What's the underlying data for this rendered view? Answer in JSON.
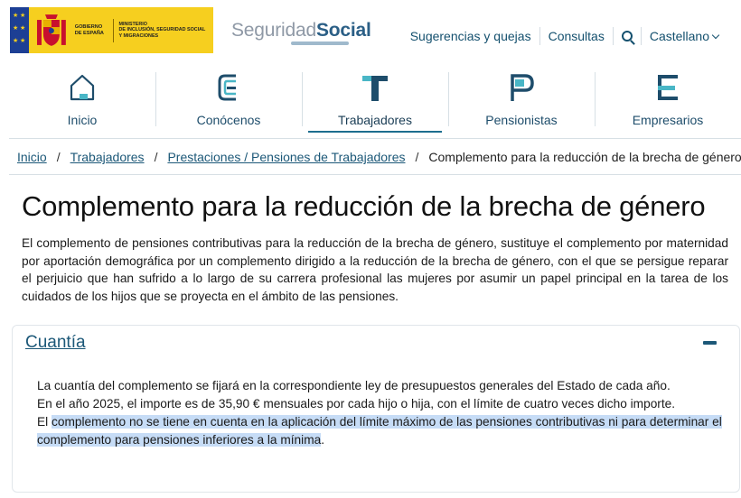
{
  "header": {
    "gov_logo": {
      "gov_line1": "GOBIERNO",
      "gov_line2": "DE ESPAÑA",
      "ministry_line1": "MINISTERIO",
      "ministry_line2": "DE INCLUSIÓN, SEGURIDAD SOCIAL",
      "ministry_line3": "Y MIGRACIONES",
      "colors": {
        "background": "#f6cf1f",
        "eu_blue": "#1d3f94"
      }
    },
    "brand": {
      "part1": "Seguridad",
      "part2": "Social"
    },
    "links": {
      "suggestions": "Sugerencias y quejas",
      "queries": "Consultas",
      "search_icon": "search-icon",
      "language": "Castellano"
    }
  },
  "nav": {
    "items": [
      {
        "label": "Inicio",
        "icon": "home-icon",
        "active": false
      },
      {
        "label": "Conócenos",
        "icon": "letter-c-icon",
        "active": false
      },
      {
        "label": "Trabajadores",
        "icon": "letter-t-icon",
        "active": true
      },
      {
        "label": "Pensionistas",
        "icon": "letter-p-icon",
        "active": false
      },
      {
        "label": "Empresarios",
        "icon": "letter-e-icon",
        "active": false
      }
    ],
    "accent_color": "#1d6e8f"
  },
  "breadcrumb": {
    "items": [
      "Inicio",
      "Trabajadores",
      "Prestaciones / Pensiones de Trabajadores"
    ],
    "separator": "/",
    "current": "Complemento para la reducción de la brecha de género"
  },
  "main": {
    "title": "Complemento para la reducción de la brecha de género",
    "intro": "El complemento de pensiones contributivas para la reducción de la brecha de género,  sustituye el complemento por maternidad por aportación demográfica por un complemento dirigido a la reducción de la brecha de género, con el que se persigue reparar el perjuicio que han sufrido a lo largo de su carrera profesional las mujeres por asumir un papel principal en la tarea de los cuidados de los hijos que se proyecta en el ámbito de las pensiones.",
    "accordion": {
      "title": "Cuantía",
      "toggle_icon": "collapse-icon",
      "lines": [
        "La cuantía  del complemento se fijará en la correspondiente ley de presupuestos generales del Estado de cada año.",
        "En el año 2025, el importe es de 35,90 € mensuales por cada hijo o hija, con el límite de cuatro veces dicho importe."
      ],
      "line3_prefix": "El ",
      "line3_highlighted": "complemento no se tiene en cuenta en la aplicación del límite máximo de las pensiones contributivas ni para determinar el complemento para pensiones inferiores a la mínima",
      "line3_suffix": ".",
      "highlight_color": "#c6dcf6"
    }
  }
}
